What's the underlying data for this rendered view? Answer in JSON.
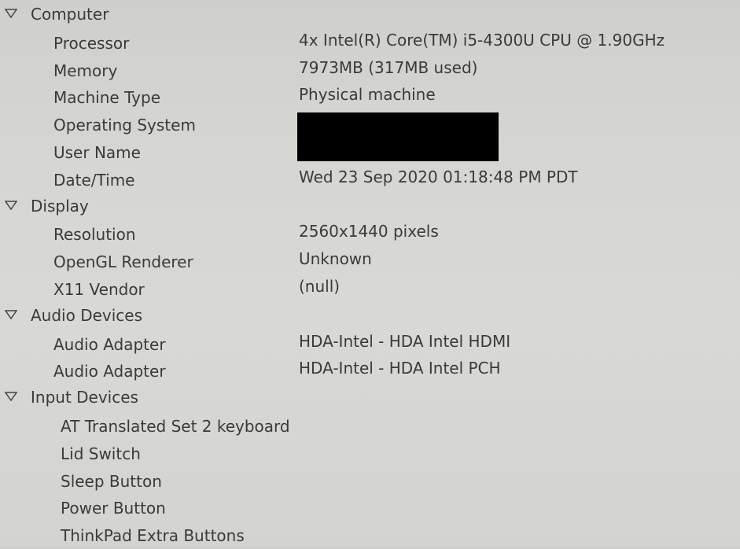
{
  "sections": [
    {
      "title": "Computer",
      "items": [
        {
          "key": "Processor",
          "value": "4x Intel(R) Core(TM) i5-4300U CPU @ 1.90GHz"
        },
        {
          "key": "Memory",
          "value": "7973MB (317MB used)"
        },
        {
          "key": "Machine Type",
          "value": "Physical machine"
        },
        {
          "key": "Operating System",
          "value": ""
        },
        {
          "key": "User Name",
          "value": ""
        },
        {
          "key": "Date/Time",
          "value": "Wed 23 Sep 2020 01:18:48 PM PDT"
        }
      ]
    },
    {
      "title": "Display",
      "items": [
        {
          "key": "Resolution",
          "value": "2560x1440 pixels"
        },
        {
          "key": "OpenGL Renderer",
          "value": "Unknown"
        },
        {
          "key": "X11 Vendor",
          "value": "(null)"
        }
      ]
    },
    {
      "title": "Audio Devices",
      "items": [
        {
          "key": "Audio Adapter",
          "value": "HDA-Intel - HDA Intel HDMI"
        },
        {
          "key": "Audio Adapter",
          "value": "HDA-Intel - HDA Intel PCH"
        }
      ]
    },
    {
      "title": "Input Devices",
      "devices": [
        "AT Translated Set 2 keyboard",
        "Lid Switch",
        "Sleep Button",
        "Power Button",
        "ThinkPad Extra Buttons"
      ]
    }
  ],
  "icons": {
    "expander": "triangle-down-icon"
  },
  "colors": {
    "background": "#d5d5d2",
    "text": "#3a3a3a",
    "redaction": "#000000"
  }
}
